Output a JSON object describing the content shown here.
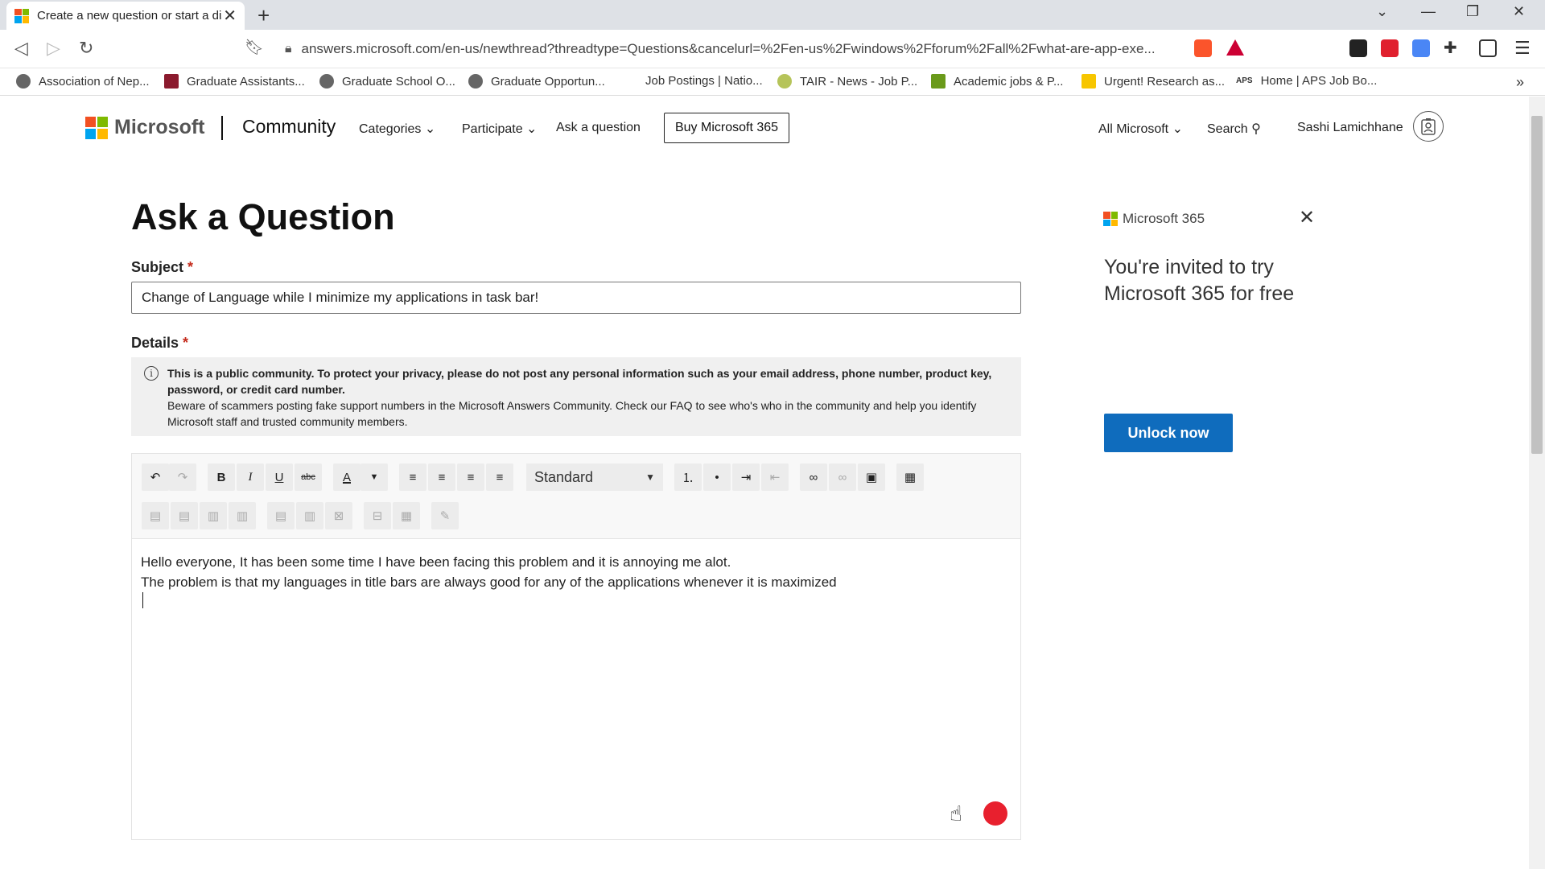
{
  "browser": {
    "tab_title": "Create a new question or start a discussion",
    "url": "answers.microsoft.com/en-us/newthread?threadtype=Questions&cancelurl=%2Fen-us%2Fwindows%2Fforum%2Fall%2Fwhat-are-app-exe...",
    "new_tab": "+",
    "bookmarks": [
      "Association of Nep...",
      "Graduate Assistants...",
      "Graduate School O...",
      "Graduate Opportun...",
      "Job Postings | Natio...",
      "TAIR - News - Job P...",
      "Academic jobs & P...",
      "Urgent! Research as...",
      "Home | APS Job Bo..."
    ],
    "aps_label": "APS",
    "more": "»"
  },
  "header": {
    "brand": "Microsoft",
    "community": "Community",
    "nav": {
      "categories": "Categories",
      "participate": "Participate",
      "ask": "Ask a question"
    },
    "buy": "Buy Microsoft 365",
    "all_microsoft": "All Microsoft",
    "search": "Search",
    "user": "Sashi Lamichhane"
  },
  "form": {
    "title": "Ask a Question",
    "subject_label": "Subject",
    "required_mark": "*",
    "subject_value": "Change of Language while I minimize my applications in task bar!",
    "details_label": "Details",
    "notice_bold": "This is a public community. To protect your privacy, please do not post any personal information such as your email address, phone number, product key, password, or credit card number.",
    "notice_text": "Beware of scammers posting fake support numbers in the Microsoft Answers Community.  Check our FAQ to see who's who in the community and help you identify Microsoft staff and trusted community members.",
    "format_select": "Standard",
    "body_line1": "Hello everyone, It has been some time I have been facing this problem and it is annoying me alot.",
    "body_line2": "The problem is that my languages in title bars are always good for any of the applications whenever it is maximized"
  },
  "ad": {
    "brand": "Microsoft 365",
    "text": "You're invited to try Microsoft 365 for free",
    "button": "Unlock now"
  },
  "colors": {
    "ms_red": "#f25022",
    "ms_green": "#7fba00",
    "ms_blue": "#00a4ef",
    "ms_yellow": "#ffb900",
    "accent": "#0f6cbd"
  }
}
